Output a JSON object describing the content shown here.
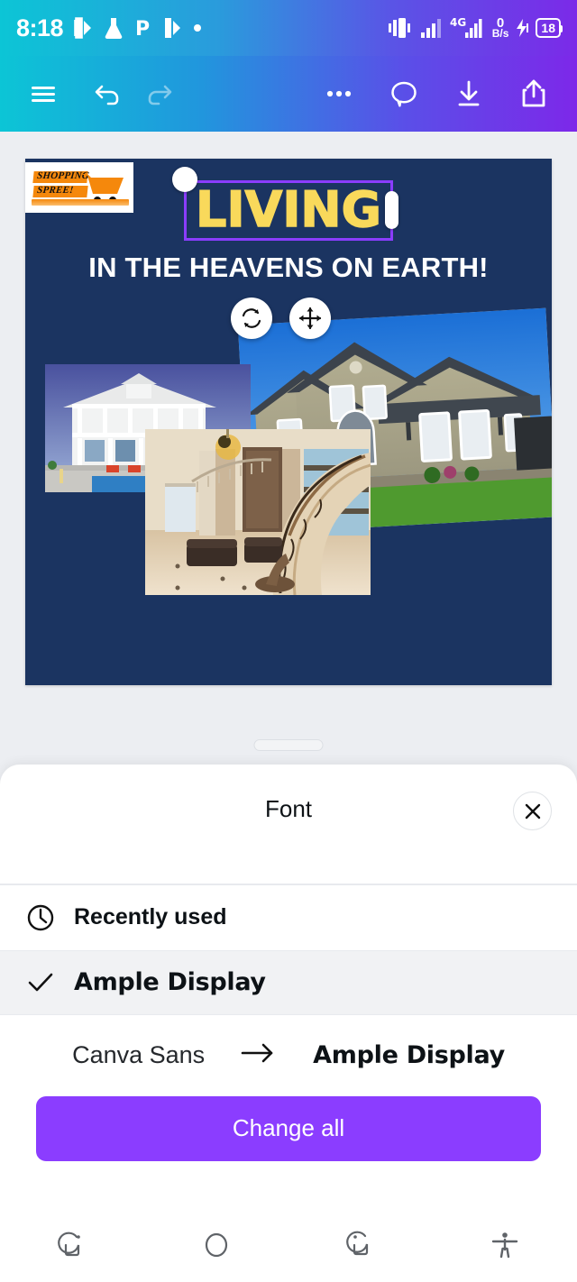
{
  "status_bar": {
    "time": "8:18",
    "left_icons": [
      "media-badge-icon",
      "flask-icon",
      "p-icon",
      "media-badge-icon",
      "dot-icon"
    ],
    "right_icons": [
      "vibrate-icon",
      "signal-bars-icon",
      "signal-4g-icon",
      "charging-bolt-icon"
    ],
    "network_type": "4G",
    "data_rate_value": "0",
    "data_rate_unit": "B/s",
    "battery_level": "18"
  },
  "toolbar": {
    "menu_label": "menu-icon",
    "undo_label": "undo-icon",
    "redo_label": "redo-icon",
    "more_label": "more-options-icon",
    "comment_label": "comment-icon",
    "download_label": "download-icon",
    "share_label": "share-icon"
  },
  "canvas": {
    "background_color": "#1b3461",
    "logo": {
      "line1": "SHOPPING",
      "line2": "SPREE!",
      "accent_color": "#F5880C"
    },
    "headline": "LIVING",
    "headline_color": "#F9D95B",
    "selection_color": "#8b3dff",
    "subtitle": "IN THE HEAVENS ON EARTH!",
    "subtitle_color": "#ffffff",
    "handles": {
      "rotate": "rotate-icon",
      "move": "move-icon"
    },
    "photos": [
      {
        "name": "photo-coastal-house"
      },
      {
        "name": "photo-suburban-mansion"
      },
      {
        "name": "photo-interior-staircase"
      }
    ]
  },
  "sheet": {
    "title": "Font",
    "close_label": "close-icon",
    "recently_used_label": "Recently used",
    "recently_used_icon": "clock-icon",
    "selected_font": "Ample Display",
    "selected_icon": "check-icon",
    "compare": {
      "from": "Canva Sans",
      "arrow": "arrow-right-icon",
      "to": "Ample Display"
    },
    "cta_label": "Change all",
    "cta_color": "#8b3dff"
  },
  "nav_bar": {
    "recents_label": "recents-icon",
    "home_label": "home-icon",
    "back_label": "back-icon",
    "accessibility_label": "accessibility-icon"
  }
}
